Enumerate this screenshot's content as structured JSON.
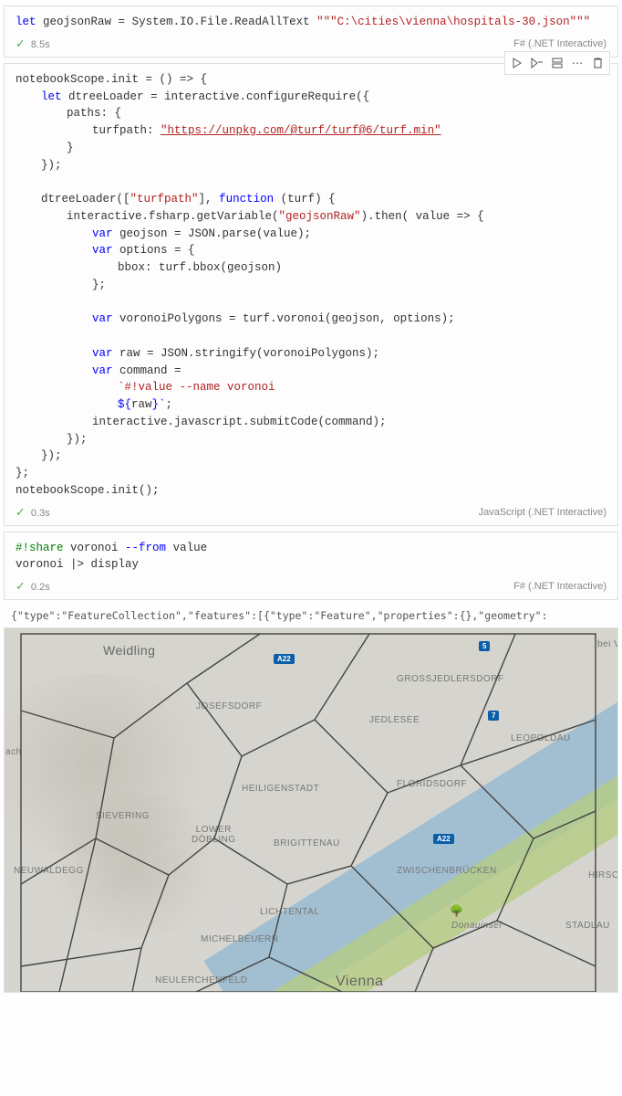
{
  "cell1": {
    "code": {
      "kw_let": "let",
      "var": "geojsonRaw",
      "call": "System.IO.File.ReadAllText",
      "str": "\"\"\"C:\\cities\\vienna\\hospitals-30.json\"\"\""
    },
    "status_time": "8.5s",
    "lang": "F# (.NET Interactive)"
  },
  "cell2": {
    "toolbar": {
      "run": "▷",
      "run_below": "▷",
      "split": "⊟",
      "more": "⋯",
      "delete": "🗑"
    },
    "code": {
      "l1a": "notebookScope.init = () => {",
      "l2": "let",
      "l2b": " dtreeLoader = interactive.configureRequire({",
      "l3": "paths: {",
      "l4a": "turfpath: ",
      "l4b": "\"https://unpkg.com/@turf/turf@6/turf.min\"",
      "l5": "}",
      "l6": "});",
      "l8a": "dtreeLoader([",
      "l8b": "\"turfpath\"",
      "l8c": "], ",
      "l8d": "function",
      "l8e": " (turf) {",
      "l9a": "interactive.fsharp.getVariable(",
      "l9b": "\"geojsonRaw\"",
      "l9c": ").then( value => {",
      "l10": "var",
      "l10b": " geojson = JSON.parse(value);",
      "l11": "var",
      "l11b": " options = {",
      "l12": "bbox: turf.bbox(geojson)",
      "l13": "};",
      "l15": "var",
      "l15b": " voronoiPolygons = turf.voronoi(geojson, options);",
      "l17": "var",
      "l17b": " raw = JSON.stringify(voronoiPolygons);",
      "l18": "var",
      "l18b": " command =",
      "l19": "`#!value --name voronoi",
      "l20a": "${",
      "l20b": "raw",
      "l20c": "}`",
      "l20d": ";",
      "l21": "interactive.javascript.submitCode(command);",
      "l22": "});",
      "l23": "});",
      "l24": "};",
      "l25": "notebookScope.init();"
    },
    "status_time": "0.3s",
    "lang": "JavaScript (.NET Interactive)"
  },
  "cell3": {
    "code": {
      "l1a": "#!",
      "l1b": "share",
      "l1c": " voronoi ",
      "l1d": "--from",
      "l1e": " value",
      "l2": "voronoi |> display"
    },
    "status_time": "0.2s",
    "lang": "F# (.NET Interactive)",
    "output": "{\"type\":\"FeatureCollection\",\"features\":[{\"type\":\"Feature\",\"properties\":{},\"geometry\":"
  },
  "map": {
    "labels": {
      "weidling": "Weidling",
      "grossjedlersdorf": "GROSSJEDLERSDORF",
      "josefsdorf": "JOSEFSDORF",
      "jedlesee": "JEDLESEE",
      "leopoldau": "LEOPOLDAU",
      "bach": "bach",
      "heiligenstadt": "HEILIGENSTADT",
      "floridsdorf": "FLORIDSDORF",
      "sievering": "SIEVERING",
      "lower_dobling": "LOWER\nDÖBLING",
      "brigittenau": "BRIGITTENAU",
      "neuwaldegg": "NEUWALDEGG",
      "zwischenbrucken": "ZWISCHENBRÜCKEN",
      "hirschst": "HIRSCHST",
      "lichtental": "LICHTENTAL",
      "donauinsel": "Donauinsel",
      "stadlau": "STADLAU",
      "michelbeuern": "MICHELBEUERN",
      "neulerchenfeld": "NEULERCHENFELD",
      "vienna": "Vienna",
      "bei": "bei V"
    },
    "shields": {
      "a22_1": "A22",
      "a22_2": "A22",
      "five": "5",
      "seven": "7"
    }
  }
}
